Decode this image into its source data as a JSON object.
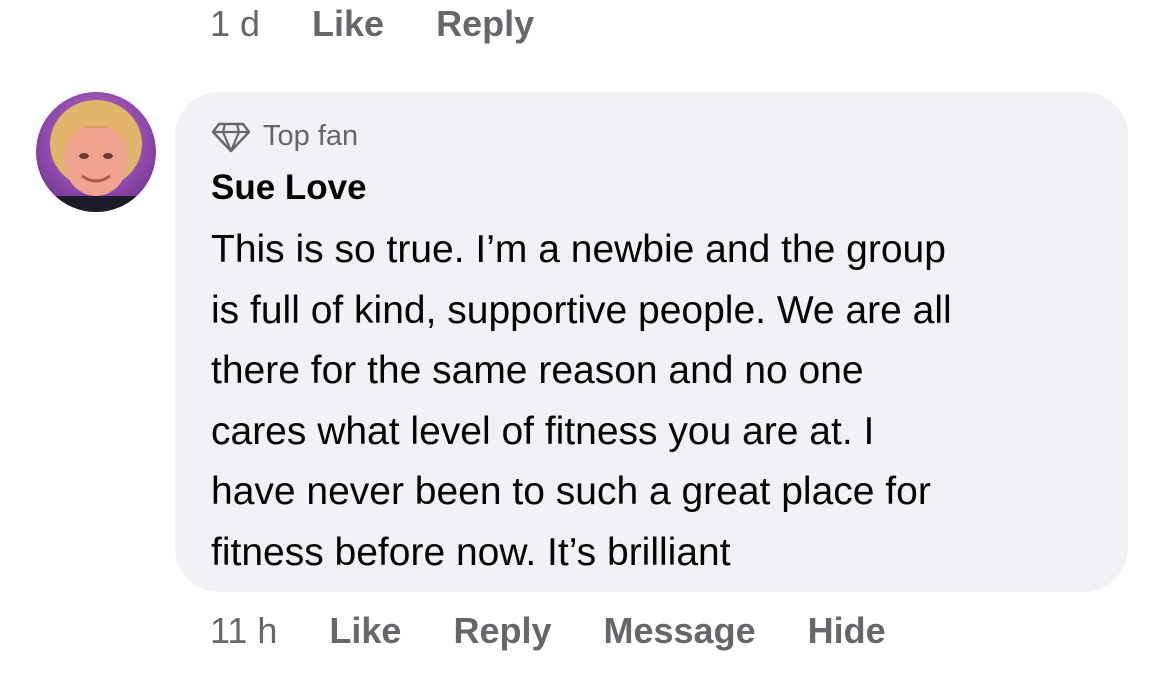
{
  "previous_comment": {
    "timestamp": "1 d",
    "like_label": "Like",
    "reply_label": "Reply"
  },
  "comment": {
    "avatar_icon": "profile-photo",
    "badge_icon": "diamond-icon",
    "badge_label": "Top fan",
    "author": "Sue Love",
    "text_lines": [
      "This is so true. I’m a newbie and the group",
      "is full of kind, supportive people. We are all",
      "there for the same reason and no one",
      "cares what level of fitness you are at. I",
      "have never been to such a great place for",
      "fitness before now. It’s brilliant"
    ],
    "timestamp": "11 h",
    "like_label": "Like",
    "reply_label": "Reply",
    "message_label": "Message",
    "hide_label": "Hide"
  },
  "colors": {
    "bubble_bg": "#f0f2f5",
    "secondary_text": "#65676b",
    "primary_text": "#050505"
  }
}
